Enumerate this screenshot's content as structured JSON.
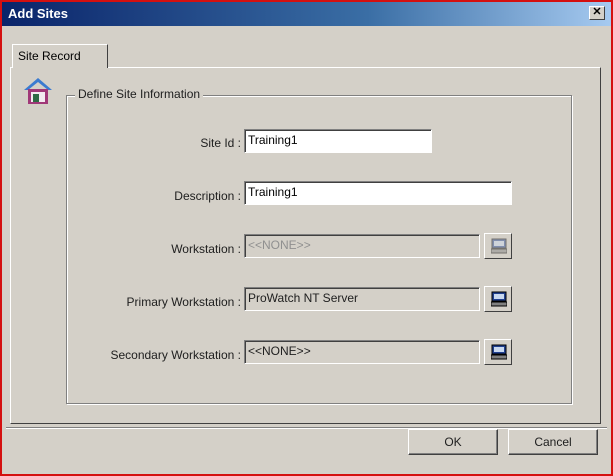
{
  "window": {
    "title": "Add Sites",
    "close_glyph": "✕"
  },
  "tabs": [
    {
      "label": "Site Record",
      "active": true
    }
  ],
  "icons": {
    "site": "house-icon",
    "browse": "workstation-browse-icon",
    "close": "close-icon"
  },
  "group": {
    "label": "Define Site Information"
  },
  "fields": {
    "site_id": {
      "label": "Site Id :",
      "value": "Training1"
    },
    "description": {
      "label": "Description :",
      "value": "Training1"
    },
    "workstation": {
      "label": "Workstation :",
      "value": "<<NONE>>",
      "enabled": false
    },
    "primary_workstation": {
      "label": "Primary Workstation :",
      "value": "ProWatch NT Server",
      "enabled": true
    },
    "secondary_workstation": {
      "label": "Secondary Workstation :",
      "value": "<<NONE>>",
      "enabled": true
    }
  },
  "buttons": {
    "ok": "OK",
    "cancel": "Cancel"
  },
  "colors": {
    "title_bar": "#0a246a",
    "dialog_bg": "#d4d0c8",
    "outline": "#d41010",
    "house_roof": "#3b7bd0",
    "house_wall": "#a03878"
  }
}
